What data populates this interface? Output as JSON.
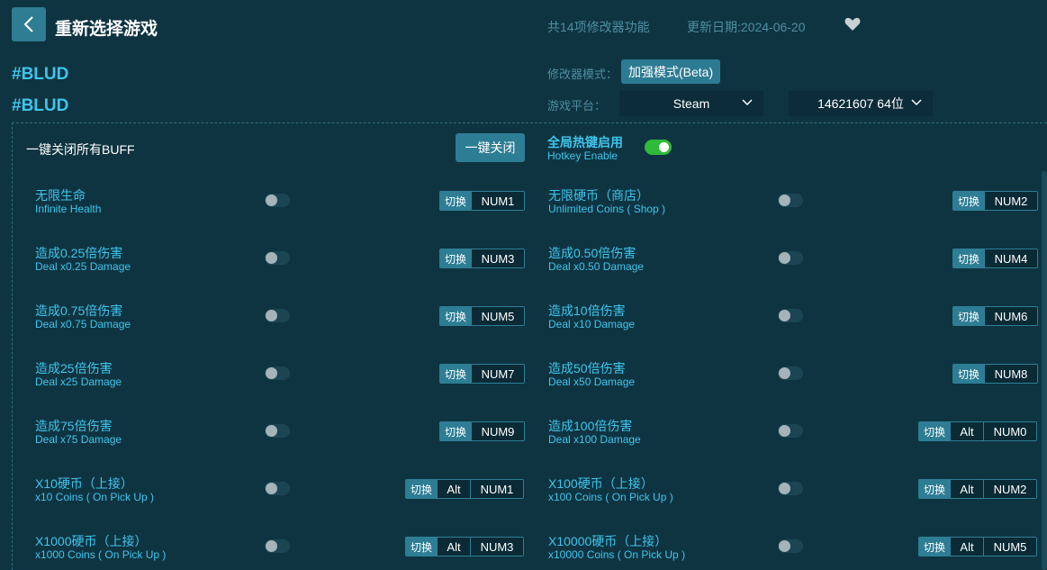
{
  "header": {
    "title": "重新选择游戏",
    "feature_count": "共14项修改器功能",
    "update_date": "更新日期:2024-06-20"
  },
  "game": {
    "name1": "#BLUD",
    "name2": "#BLUD"
  },
  "mode": {
    "label": "修改器模式：",
    "value": "加强模式(Beta)"
  },
  "platform": {
    "label": "游戏平台：",
    "selected": "Steam",
    "version": "14621607 64位"
  },
  "controls": {
    "buff_label": "一键关闭所有BUFF",
    "close_all": "一键关闭",
    "hotkey_cn": "全局热键启用",
    "hotkey_en": "Hotkey Enable",
    "switch_label": "切换"
  },
  "features": [
    {
      "cn": "无限生命",
      "en": "Infinite Health",
      "keys": [
        "NUM1"
      ]
    },
    {
      "cn": "无限硬币（商店）",
      "en": "Unlimited Coins ( Shop )",
      "keys": [
        "NUM2"
      ]
    },
    {
      "cn": "造成0.25倍伤害",
      "en": "Deal x0.25 Damage",
      "keys": [
        "NUM3"
      ]
    },
    {
      "cn": "造成0.50倍伤害",
      "en": "Deal x0.50 Damage",
      "keys": [
        "NUM4"
      ]
    },
    {
      "cn": "造成0.75倍伤害",
      "en": "Deal x0.75 Damage",
      "keys": [
        "NUM5"
      ]
    },
    {
      "cn": "造成10倍伤害",
      "en": "Deal x10 Damage",
      "keys": [
        "NUM6"
      ]
    },
    {
      "cn": "造成25倍伤害",
      "en": "Deal x25 Damage",
      "keys": [
        "NUM7"
      ]
    },
    {
      "cn": "造成50倍伤害",
      "en": "Deal x50 Damage",
      "keys": [
        "NUM8"
      ]
    },
    {
      "cn": "造成75倍伤害",
      "en": "Deal x75 Damage",
      "keys": [
        "NUM9"
      ]
    },
    {
      "cn": "造成100倍伤害",
      "en": "Deal x100 Damage",
      "keys": [
        "Alt",
        "NUM0"
      ]
    },
    {
      "cn": "X10硬币（上接）",
      "en": "x10 Coins ( On Pick Up )",
      "keys": [
        "Alt",
        "NUM1"
      ]
    },
    {
      "cn": "X100硬币（上接）",
      "en": "x100 Coins ( On Pick Up )",
      "keys": [
        "Alt",
        "NUM2"
      ]
    },
    {
      "cn": "X1000硬币（上接）",
      "en": "x1000 Coins ( On Pick Up )",
      "keys": [
        "Alt",
        "NUM3"
      ]
    },
    {
      "cn": "X10000硬币（上接）",
      "en": "x10000 Coins ( On Pick Up )",
      "keys": [
        "Alt",
        "NUM5"
      ]
    }
  ]
}
